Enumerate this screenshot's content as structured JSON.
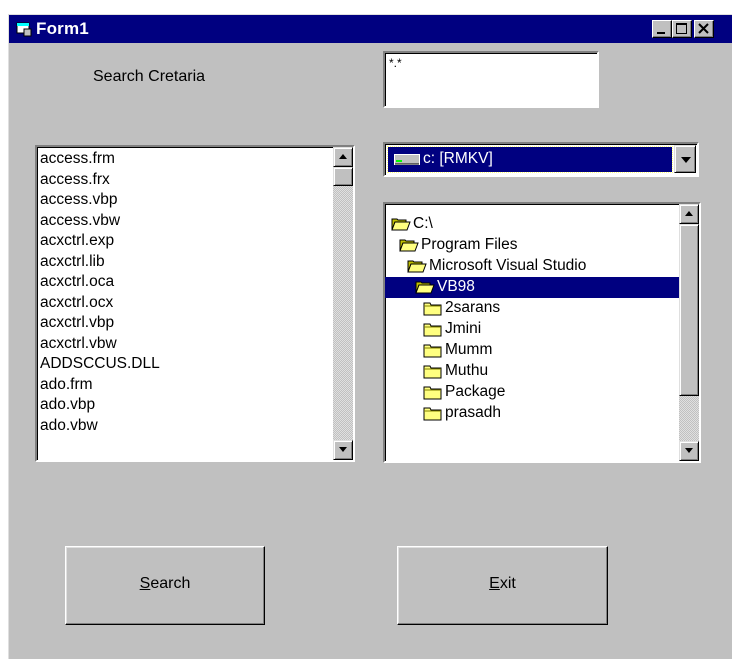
{
  "window": {
    "title": "Form1"
  },
  "labels": {
    "search_criteria": "Search Cretaria"
  },
  "pattern_input": {
    "value": "*.*"
  },
  "file_list": {
    "items": [
      "access.frm",
      "access.frx",
      "access.vbp",
      "access.vbw",
      "acxctrl.exp",
      "acxctrl.lib",
      "acxctrl.oca",
      "acxctrl.ocx",
      "acxctrl.vbp",
      "acxctrl.vbw",
      "ADDSCCUS.DLL",
      "ado.frm",
      "ado.vbp",
      "ado.vbw"
    ]
  },
  "drive_combo": {
    "selected": "c: [RMKV]"
  },
  "dir_list": {
    "items": [
      {
        "name": "C:\\",
        "level": 0,
        "open": true
      },
      {
        "name": "Program Files",
        "level": 1,
        "open": true
      },
      {
        "name": "Microsoft Visual Studio",
        "level": 2,
        "open": true
      },
      {
        "name": "VB98",
        "level": 3,
        "open": true,
        "selected": true
      },
      {
        "name": "2sarans",
        "level": 4,
        "open": false
      },
      {
        "name": "Jmini",
        "level": 4,
        "open": false
      },
      {
        "name": "Mumm",
        "level": 4,
        "open": false
      },
      {
        "name": "Muthu",
        "level": 4,
        "open": false
      },
      {
        "name": "Package",
        "level": 4,
        "open": false
      },
      {
        "name": "prasadh",
        "level": 4,
        "open": false
      }
    ]
  },
  "buttons": {
    "search": {
      "mnemonic": "S",
      "rest": "earch"
    },
    "exit": {
      "mnemonic": "E",
      "rest": "xit"
    }
  },
  "icons": {
    "app": "form-icon",
    "minimize": "minimize-icon",
    "maximize": "maximize-icon",
    "close": "close-icon",
    "drive": "hard-drive-icon",
    "folder_open": "open-folder-icon",
    "folder_closed": "closed-folder-icon"
  },
  "colors": {
    "titlebar": "#000080",
    "face": "#c0c0c0",
    "selection": "#000080",
    "folder": "#ffff80"
  }
}
